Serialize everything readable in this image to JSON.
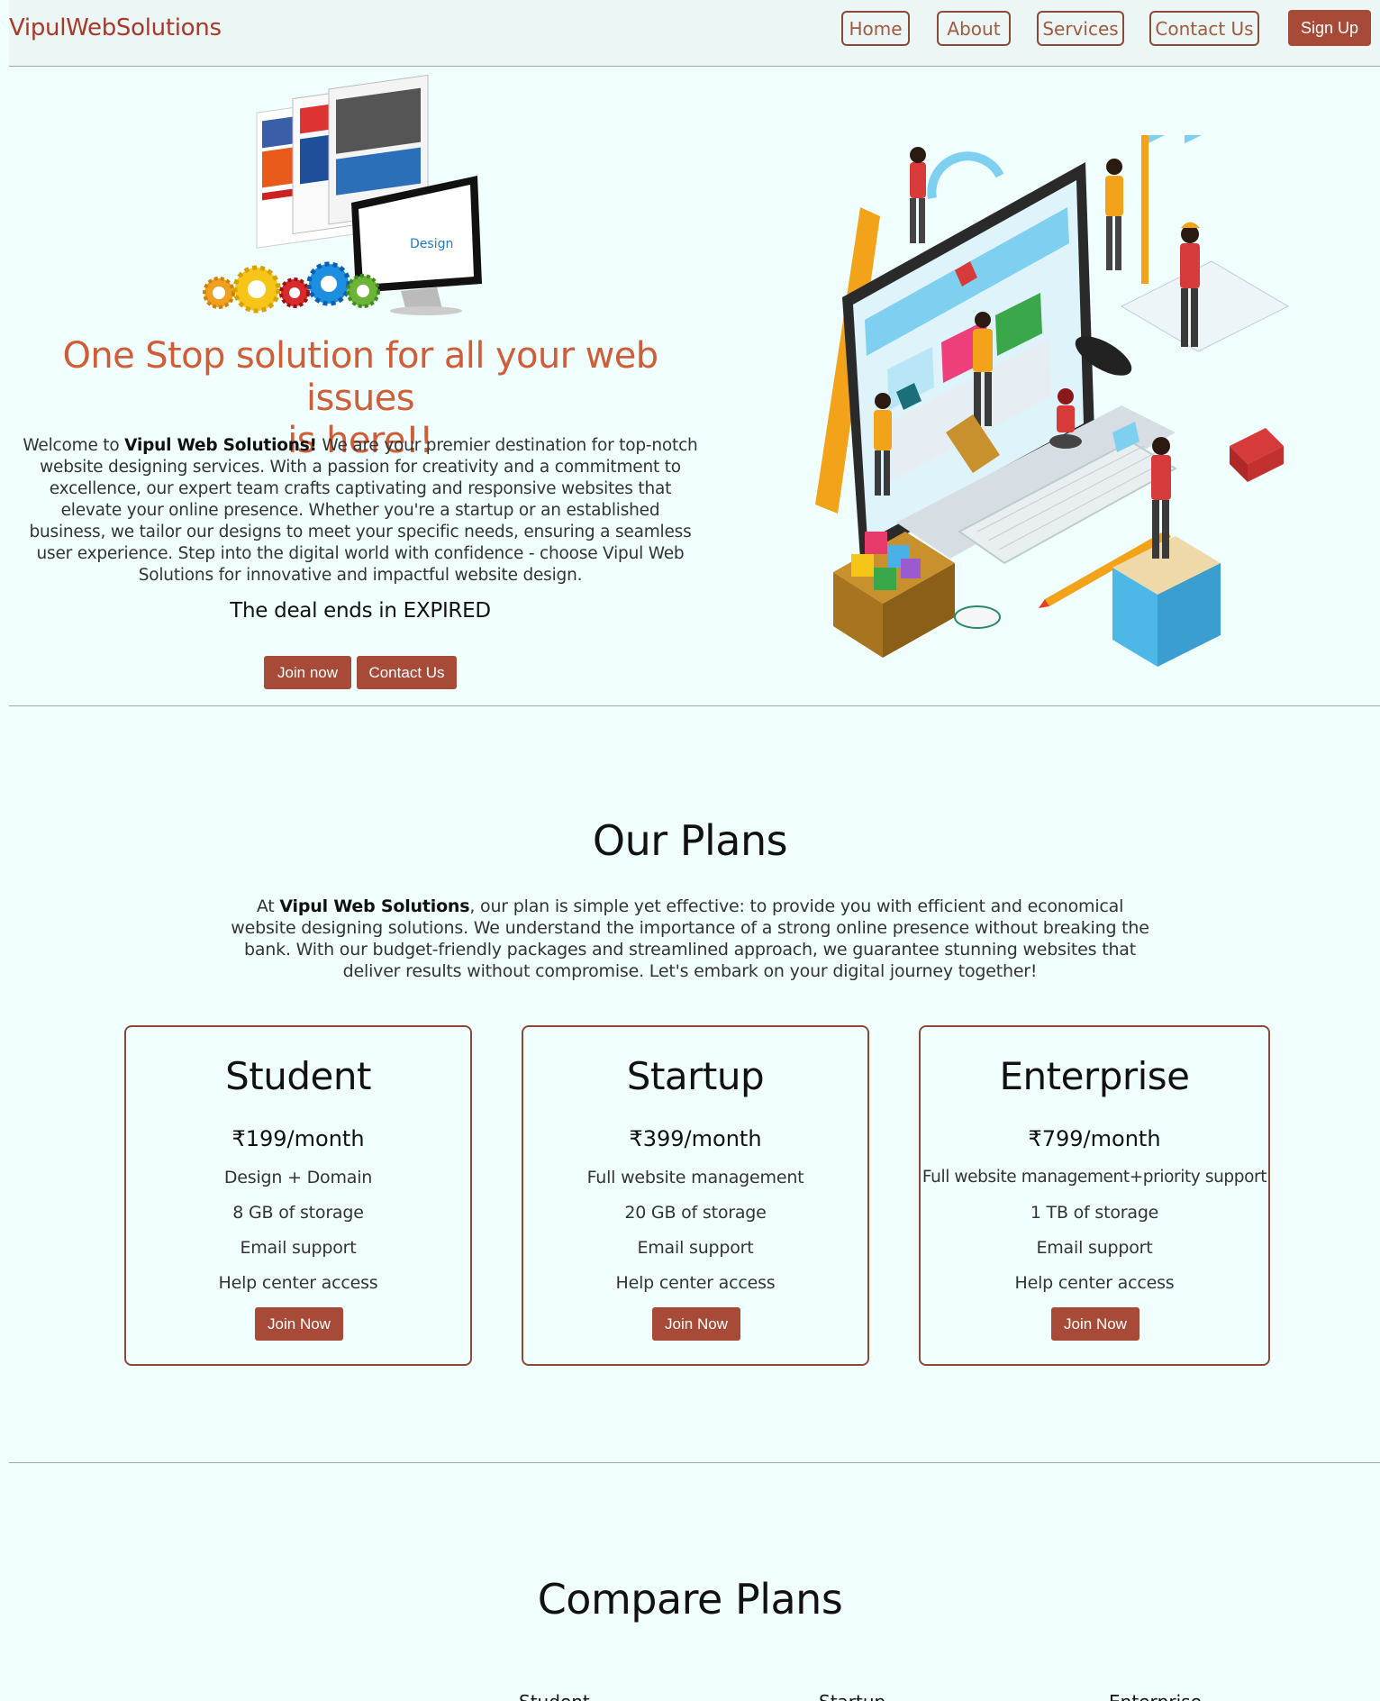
{
  "nav": {
    "brand": "VipulWebSolutions",
    "links": [
      "Home",
      "About",
      "Services",
      "Contact Us"
    ],
    "signup": "Sign Up"
  },
  "hero": {
    "title_line1": "One Stop solution for all your web issues",
    "title_line2": "is here!!",
    "text_prefix": "Welcome to ",
    "text_bold": "Vipul Web Solutions!",
    "text_rest": " We are your premier destination for top-notch website designing services. With a passion for creativity and a commitment to excellence, our expert team crafts captivating and responsive websites that elevate your online presence. Whether you're a startup or an established business, we tailor our designs to meet your specific needs, ensuring a seamless user experience. Step into the digital world with confidence - choose Vipul Web Solutions for innovative and impactful website design.",
    "deal": "The deal ends in EXPIRED",
    "join_btn": "Join now",
    "contact_btn": "Contact Us"
  },
  "plans": {
    "title": "Our Plans",
    "text_prefix": "At ",
    "text_bold": "Vipul Web Solutions",
    "text_rest": ", our plan is simple yet effective: to provide you with efficient and economical website designing solutions. We understand the importance of a strong online presence without breaking the bank. With our budget-friendly packages and streamlined approach, we guarantee stunning websites that deliver results without compromise. Let's embark on your digital journey together!",
    "cards": [
      {
        "name": "Student",
        "price": "₹199/month",
        "features": [
          "Design + Domain",
          "8 GB of storage",
          "Email support",
          "Help center access"
        ],
        "button": "Join Now"
      },
      {
        "name": "Startup",
        "price": "₹399/month",
        "features": [
          "Full website management",
          "20 GB of storage",
          "Email support",
          "Help center access"
        ],
        "button": "Join Now"
      },
      {
        "name": "Enterprise",
        "price": "₹799/month",
        "features": [
          "Full website management+priority support",
          "1 TB of storage",
          "Email support",
          "Help center access"
        ],
        "button": "Join Now"
      }
    ]
  },
  "compare": {
    "title": "Compare Plans",
    "columns": [
      "Student",
      "Startup",
      "Enterprise"
    ]
  },
  "colors": {
    "accent": "#a84a38",
    "brand": "#a8392a",
    "hero_title": "#cf5e38",
    "background": "#f0fffe"
  }
}
